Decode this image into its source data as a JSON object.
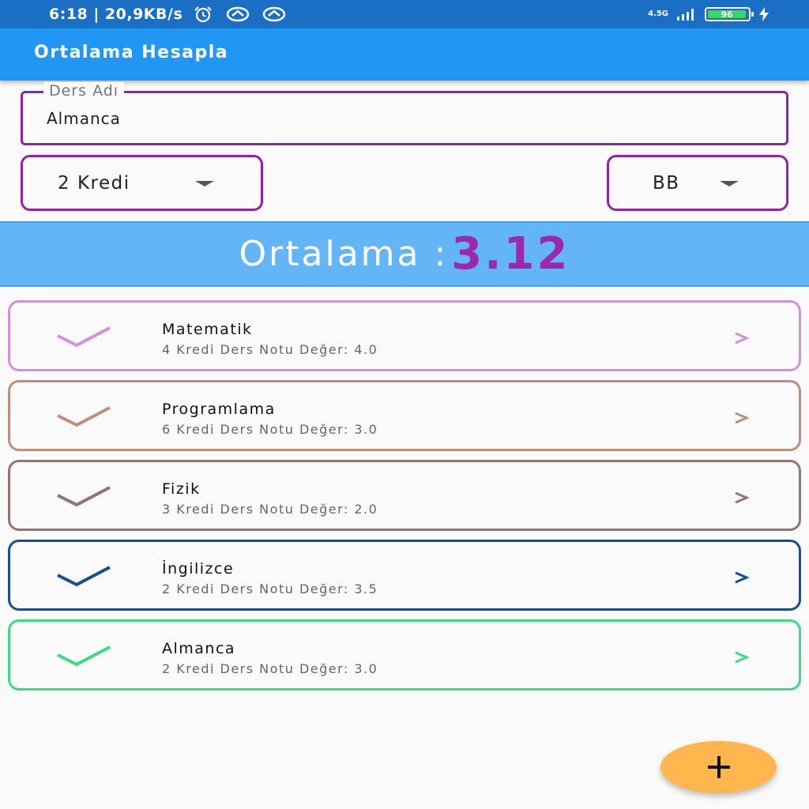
{
  "status_bar": {
    "time_speed": "6:18 | 20,9KB/s",
    "network_type": "4.5G",
    "battery_level": "96",
    "battery_fraction": 0.96
  },
  "app_bar": {
    "title": "Ortalama Hesapla"
  },
  "course_form": {
    "name_label": "Ders Adı",
    "name_value": "Almanca",
    "credit_selected": "2 Kredi",
    "grade_selected": "BB"
  },
  "average": {
    "label": "Ortalama :",
    "value": "3.12"
  },
  "courses": [
    {
      "name": "Matematik",
      "detail": "4 Kredi Ders Notu Değer: 4.0",
      "color": "#ce93d8"
    },
    {
      "name": "Programlama",
      "detail": "6 Kredi Ders Notu Değer: 3.0",
      "color": "#bc8f7f"
    },
    {
      "name": "Fizik",
      "detail": "3 Kredi Ders Notu Değer: 2.0",
      "color": "#927572"
    },
    {
      "name": "İngilizce",
      "detail": "2 Kredi Ders Notu Değer: 3.5",
      "color": "#1a4d91"
    },
    {
      "name": "Almanca",
      "detail": "2 Kredi Ders Notu Değer: 3.0",
      "color": "#3ddc84"
    }
  ],
  "icons": {
    "status": [
      "alarm-icon",
      "sync-icon",
      "sync-icon",
      "signal-icon",
      "battery-icon",
      "charging-icon"
    ],
    "course_leading": "check-icon",
    "course_trailing": "chevron-right-icon",
    "fab": "plus-icon"
  },
  "colors": {
    "app_bar": "#2196f3",
    "status_bar": "#1a6fc4",
    "form_border": "#8e24aa",
    "average_banner": "#64b5f6",
    "average_value": "#9c27b0",
    "fab": "#ffb74d"
  }
}
